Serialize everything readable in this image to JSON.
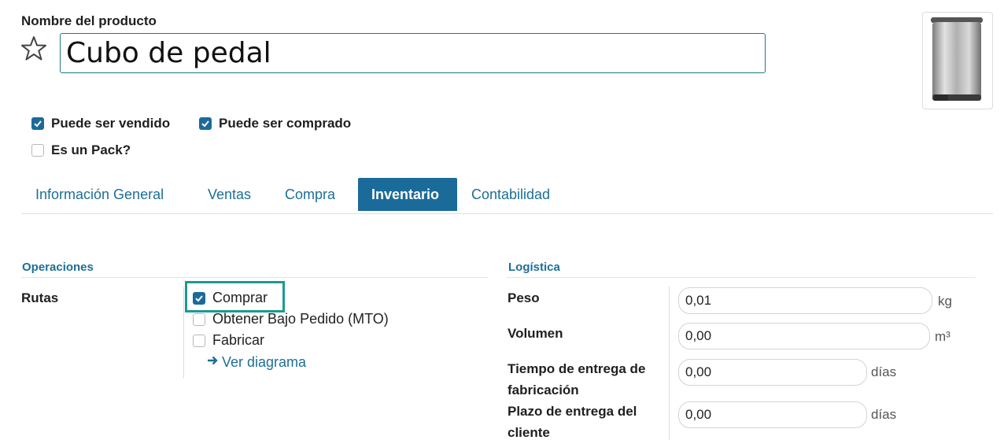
{
  "header": {
    "product_name_label": "Nombre del producto",
    "product_name_value": "Cubo de pedal"
  },
  "options": [
    {
      "label": "Puede ser vendido",
      "checked": true
    },
    {
      "label": "Puede ser comprado",
      "checked": true
    },
    {
      "label": "Es un Pack?",
      "checked": false
    }
  ],
  "tabs": [
    {
      "label": "Información General",
      "active": false
    },
    {
      "label": "Ventas",
      "active": false
    },
    {
      "label": "Compra",
      "active": false
    },
    {
      "label": "Inventario",
      "active": true
    },
    {
      "label": "Contabilidad",
      "active": false
    }
  ],
  "operaciones": {
    "title": "Operaciones",
    "routes_label": "Rutas",
    "routes": [
      {
        "label": "Comprar",
        "checked": true
      },
      {
        "label": "Obtener Bajo Pedido (MTO)",
        "checked": false
      },
      {
        "label": "Fabricar",
        "checked": false
      }
    ],
    "diagram_link": "Ver diagrama"
  },
  "logistica": {
    "title": "Logística",
    "fields": [
      {
        "label": "Peso",
        "value": "0,01",
        "unit": "kg"
      },
      {
        "label": "Volumen",
        "value": "0,00",
        "unit": "m³"
      },
      {
        "label": "Tiempo de entrega de fabricación",
        "value": "0,00",
        "unit": "días"
      },
      {
        "label": "Plazo de entrega del cliente",
        "value": "0,00",
        "unit": "días"
      }
    ]
  },
  "colors": {
    "accent": "#1b6b9a",
    "link": "#1d6f95",
    "highlight": "#1c9a93"
  }
}
